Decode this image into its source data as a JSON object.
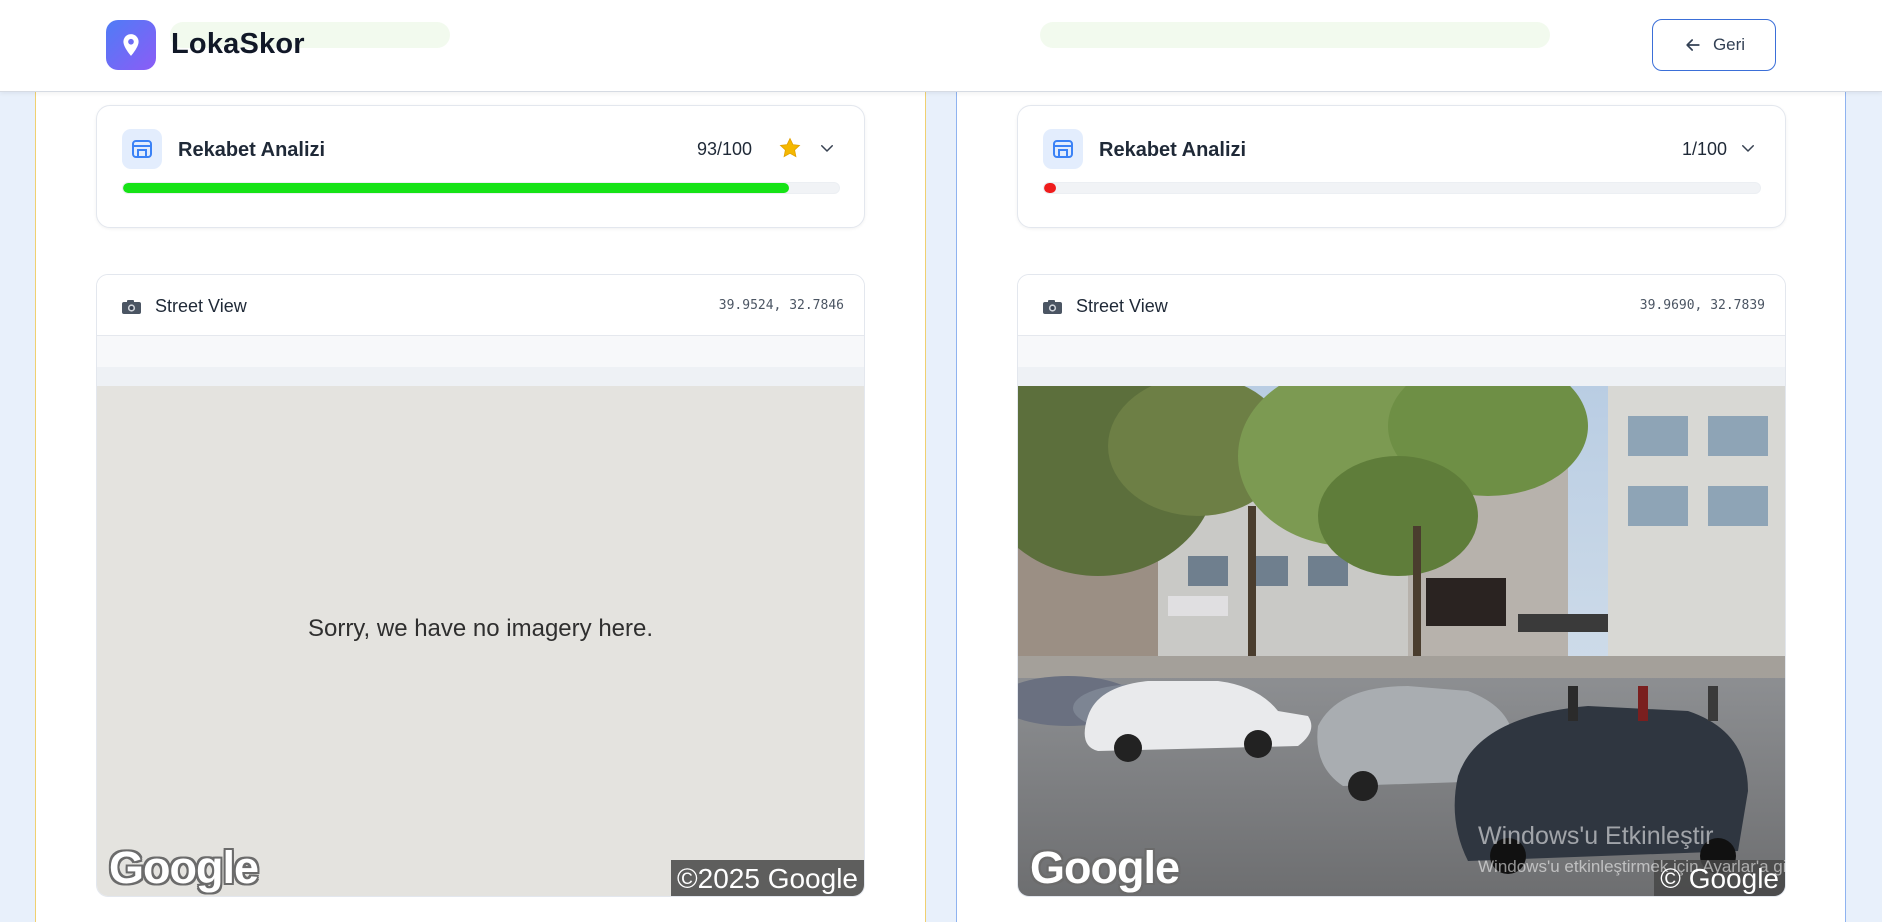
{
  "header": {
    "brand": "LokaSkor",
    "back_label": "Geri"
  },
  "left": {
    "card_title": "Rekabet Analizi",
    "score": "93/100",
    "progress_fraction": 0.93,
    "progress_color": "#16e316",
    "streetview": {
      "title": "Street View",
      "coords": "39.9524, 32.7846",
      "message": "Sorry, we have no imagery here.",
      "logo": "Google",
      "copyright": "©2025 Google"
    }
  },
  "right": {
    "card_title": "Rekabet Analizi",
    "score": "1/100",
    "progress_fraction": 0.01,
    "progress_color": "#ef1c1c",
    "streetview": {
      "title": "Street View",
      "coords": "39.9690, 32.7839",
      "logo": "Google",
      "copyright": "© Google"
    }
  },
  "watermark": {
    "line1": "Windows'u Etkinleştir",
    "line2": "Windows'u etkinleştirmek için Ayarlar'a gidin."
  },
  "colors": {
    "accent": "#3b6fd8",
    "left_column_border": "#f0d070",
    "right_column_border": "#8fb3f0",
    "star": "#f5b800"
  },
  "icons": {
    "logo": "map-pin-icon",
    "back": "arrow-left-icon",
    "card": "store-icon",
    "rating": "star-icon",
    "expand": "chevron-down-icon",
    "streetview": "camera-icon"
  }
}
